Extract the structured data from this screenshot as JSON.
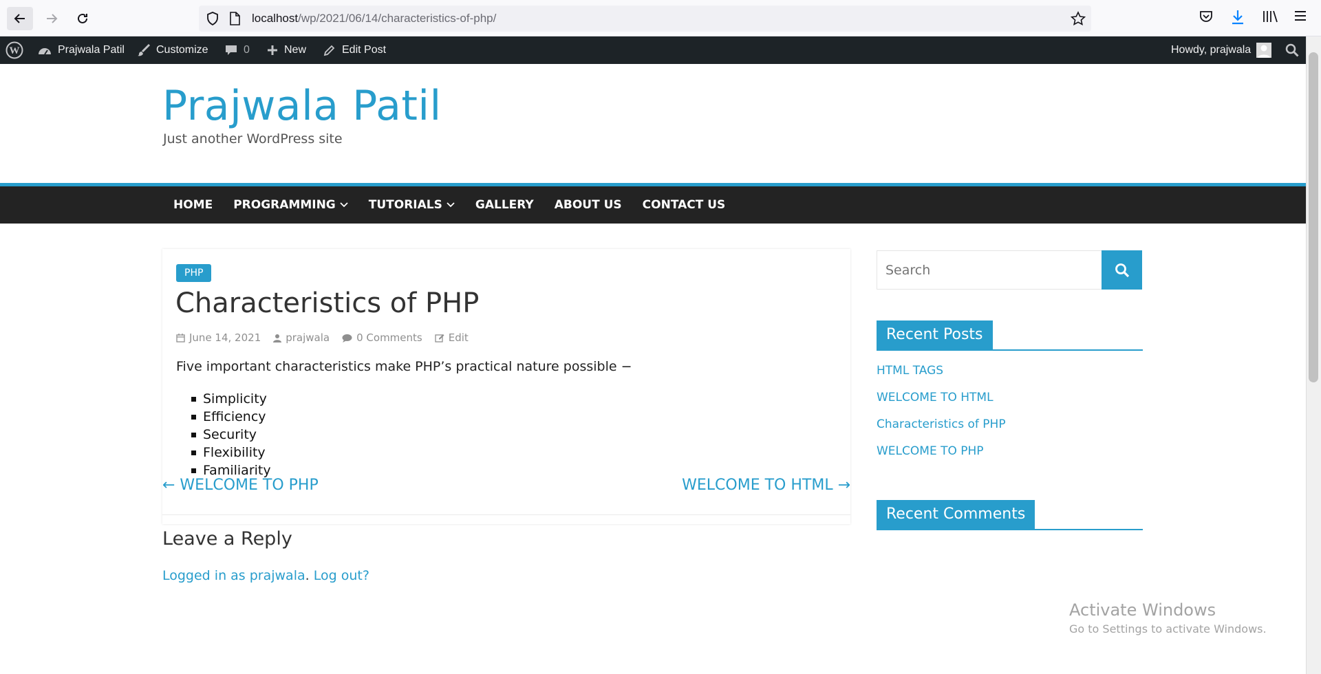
{
  "browser": {
    "url_host": "localhost",
    "url_path": "/wp/2021/06/14/characteristics-of-php/"
  },
  "admin_bar": {
    "site_name": "Prajwala Patil",
    "customize": "Customize",
    "comments_count": "0",
    "new": "New",
    "edit_post": "Edit Post",
    "howdy": "Howdy, prajwala"
  },
  "site": {
    "title": "Prajwala Patil",
    "tagline": "Just another WordPress site"
  },
  "menu": {
    "items": [
      {
        "label": "HOME"
      },
      {
        "label": "PROGRAMMING"
      },
      {
        "label": "TUTORIALS"
      },
      {
        "label": "GALLERY"
      },
      {
        "label": "ABOUT US"
      },
      {
        "label": "CONTACT US"
      }
    ]
  },
  "post": {
    "category": "PHP",
    "title": "Characteristics of PHP",
    "date": "June 14, 2021",
    "author": "prajwala",
    "comments": "0 Comments",
    "edit": "Edit",
    "intro": "Five important characteristics make PHP’s practical nature possible −",
    "items": [
      "Simplicity",
      "Efficiency",
      "Security",
      "Flexibility",
      "Familiarity"
    ]
  },
  "post_nav": {
    "prev": "← WELCOME TO PHP",
    "next": "WELCOME TO HTML →"
  },
  "reply": {
    "title": "Leave a Reply",
    "logged_in": "Logged in as prajwala",
    "logout": "Log out?"
  },
  "sidebar": {
    "search_placeholder": "Search",
    "recent_posts_title": "Recent Posts",
    "recent_posts": [
      "HTML TAGS",
      "WELCOME TO HTML",
      "Characteristics of PHP",
      "WELCOME TO PHP"
    ],
    "recent_comments_title": "Recent Comments"
  },
  "watermark": {
    "line1": "Activate Windows",
    "line2": "Go to Settings to activate Windows."
  },
  "colors": {
    "accent": "#289dcc",
    "admin_bar": "#1d2327",
    "nav": "#232323"
  }
}
